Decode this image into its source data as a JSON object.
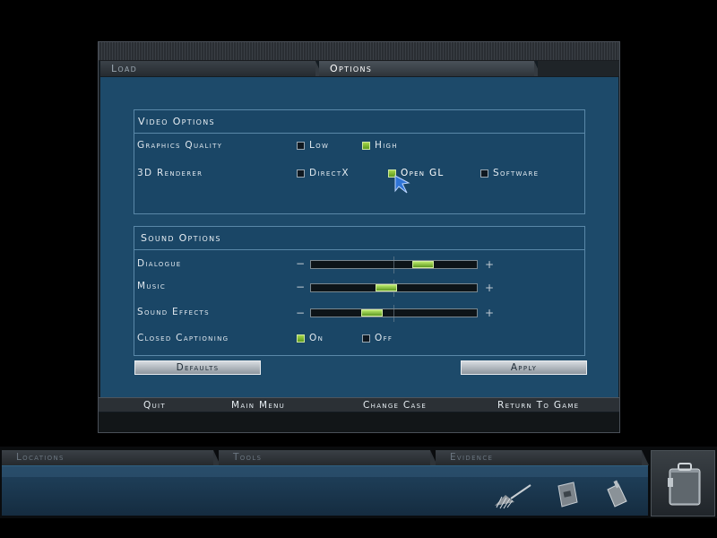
{
  "tabs": {
    "load": "Load",
    "options": "Options"
  },
  "video": {
    "title": "Video Options",
    "graphics_quality": {
      "label": "Graphics Quality",
      "options": [
        {
          "label": "Low",
          "checked": false
        },
        {
          "label": "High",
          "checked": true
        }
      ]
    },
    "renderer": {
      "label": "3D Renderer",
      "options": [
        {
          "label": "DirectX",
          "checked": false
        },
        {
          "label": "Open GL",
          "checked": true
        },
        {
          "label": "Software",
          "checked": false
        }
      ]
    }
  },
  "sound": {
    "title": "Sound Options",
    "sliders": [
      {
        "label": "Dialogue",
        "level": 0.7
      },
      {
        "label": "Music",
        "level": 0.45
      },
      {
        "label": "Sound Effects",
        "level": 0.35
      }
    ],
    "minus": "−",
    "plus": "+",
    "captioning": {
      "label": "Closed Captioning",
      "options": [
        {
          "label": "On",
          "checked": true
        },
        {
          "label": "Off",
          "checked": false
        }
      ]
    }
  },
  "buttons": {
    "defaults": "Defaults",
    "apply": "Apply"
  },
  "nav": {
    "quit": "Quit",
    "main_menu": "Main Menu",
    "change_case": "Change Case",
    "return_to_game": "Return To Game"
  },
  "inventory": {
    "tabs": [
      "Locations",
      "Tools",
      "Evidence"
    ],
    "items": [
      "brush-icon",
      "evidence-bag-icon",
      "fingerprint-kit-icon"
    ],
    "case_icon": "briefcase-icon"
  },
  "colors": {
    "panel": "#1d4a6a",
    "checked": "#8cc63f",
    "slider_thumb": "#9ad24a",
    "cursor": "#2f74d6"
  }
}
